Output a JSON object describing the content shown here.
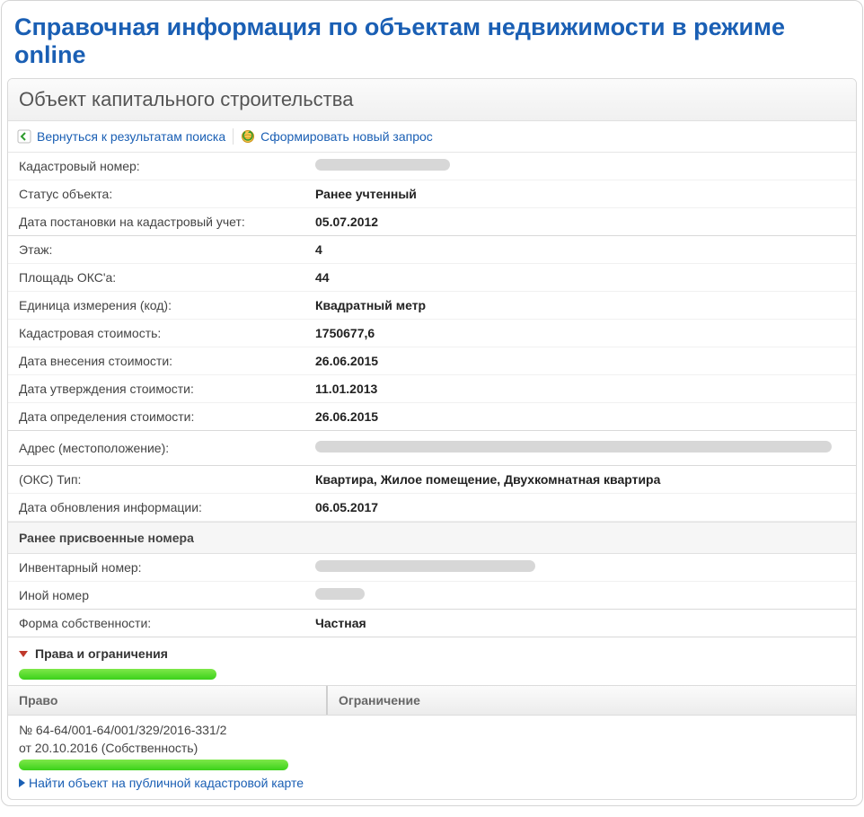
{
  "title": "Справочная информация по объектам недвижимости в режиме online",
  "panel_header": "Объект капитального строительства",
  "toolbar": {
    "back": "Вернуться к результатам поиска",
    "new_query": "Сформировать новый запрос"
  },
  "fields": {
    "cad_number_label": "Кадастровый номер:",
    "status_label": "Статус объекта:",
    "status_value": "Ранее учтенный",
    "reg_date_label": "Дата постановки на кадастровый учет:",
    "reg_date_value": "05.07.2012",
    "floor_label": "Этаж:",
    "floor_value": "4",
    "area_label": "Площадь ОКС'а:",
    "area_value": "44",
    "unit_label": "Единица измерения (код):",
    "unit_value": "Квадратный метр",
    "cad_cost_label": "Кадастровая стоимость:",
    "cad_cost_value": "1750677,6",
    "cost_entry_label": "Дата внесения стоимости:",
    "cost_entry_value": "26.06.2015",
    "cost_appr_label": "Дата утверждения стоимости:",
    "cost_appr_value": "11.01.2013",
    "cost_det_label": "Дата определения стоимости:",
    "cost_det_value": "26.06.2015",
    "address_label": "Адрес (местоположение):",
    "oks_type_label": "(ОКС) Тип:",
    "oks_type_value": "Квартира, Жилое помещение, Двухкомнатная квартира",
    "upd_label": "Дата обновления информации:",
    "upd_value": "06.05.2017",
    "prev_numbers_header": "Ранее присвоенные номера",
    "inv_label": "Инвентарный номер:",
    "other_label": "Иной номер",
    "ownform_label": "Форма собственности:",
    "ownform_value": "Частная"
  },
  "rights_section": "Права и ограничения",
  "rights_table": {
    "col_right": "Право",
    "col_limit": "Ограничение",
    "row1_line1": "№ 64-64/001-64/001/329/2016-331/2",
    "row1_line2": "от 20.10.2016  (Собственность)"
  },
  "map_link": "Найти объект на публичной кадастровой карте"
}
